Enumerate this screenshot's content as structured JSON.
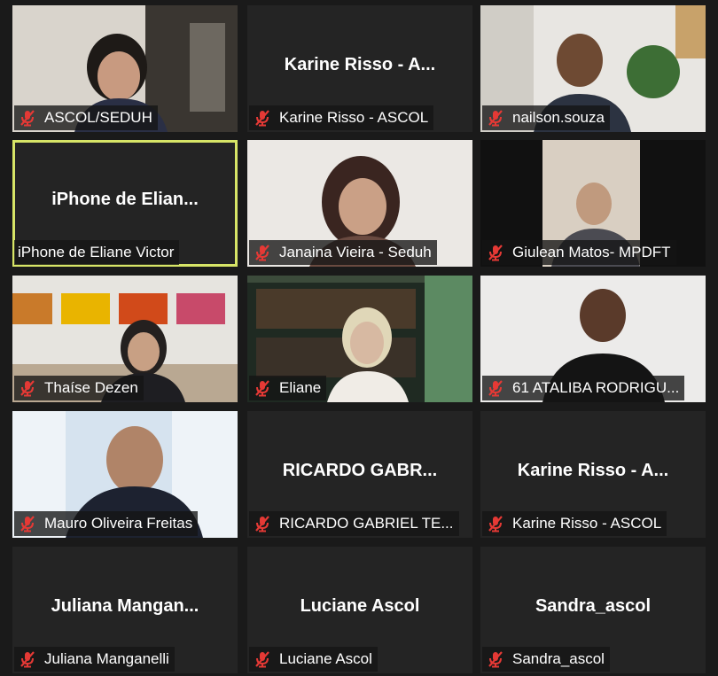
{
  "participants": [
    {
      "label": "ASCOL/SEDUH",
      "center_name": "",
      "has_video": true,
      "muted": true
    },
    {
      "label": "Karine Risso - ASCOL",
      "center_name": "Karine Risso - A...",
      "has_video": false,
      "muted": true
    },
    {
      "label": "nailson.souza",
      "center_name": "",
      "has_video": true,
      "muted": true
    },
    {
      "label": "iPhone de Eliane Victor",
      "center_name": "iPhone  de  Elian...",
      "has_video": false,
      "muted": false,
      "active_speaker": true
    },
    {
      "label": "Janaina Vieira - Seduh",
      "center_name": "",
      "has_video": true,
      "muted": true
    },
    {
      "label": "Giulean Matos- MPDFT",
      "center_name": "",
      "has_video": true,
      "muted": true
    },
    {
      "label": "Thaíse Dezen",
      "center_name": "",
      "has_video": true,
      "muted": true
    },
    {
      "label": "Eliane",
      "center_name": "",
      "has_video": true,
      "muted": true
    },
    {
      "label": "61 ATALIBA RODRIGU...",
      "center_name": "",
      "has_video": true,
      "muted": true
    },
    {
      "label": "Mauro Oliveira Freitas",
      "center_name": "",
      "has_video": true,
      "muted": true
    },
    {
      "label": "RICARDO GABRIEL TE...",
      "center_name": "RICARDO GABR...",
      "has_video": false,
      "muted": true
    },
    {
      "label": "Karine Risso - ASCOL",
      "center_name": "Karine Risso - A...",
      "has_video": false,
      "muted": true
    },
    {
      "label": "Juliana Manganelli",
      "center_name": "Juliana  Mangan...",
      "has_video": false,
      "muted": true
    },
    {
      "label": "Luciane Ascol",
      "center_name": "Luciane Ascol",
      "has_video": false,
      "muted": true
    },
    {
      "label": "Sandra_ascol",
      "center_name": "Sandra_ascol",
      "has_video": false,
      "muted": true
    }
  ],
  "colors": {
    "background": "#1a1a1a",
    "tile": "#242424",
    "active_border": "#d7e567",
    "muted_mic": "#e53935",
    "text": "#ffffff"
  },
  "icons": {
    "muted_mic": "muted-microphone-icon"
  }
}
